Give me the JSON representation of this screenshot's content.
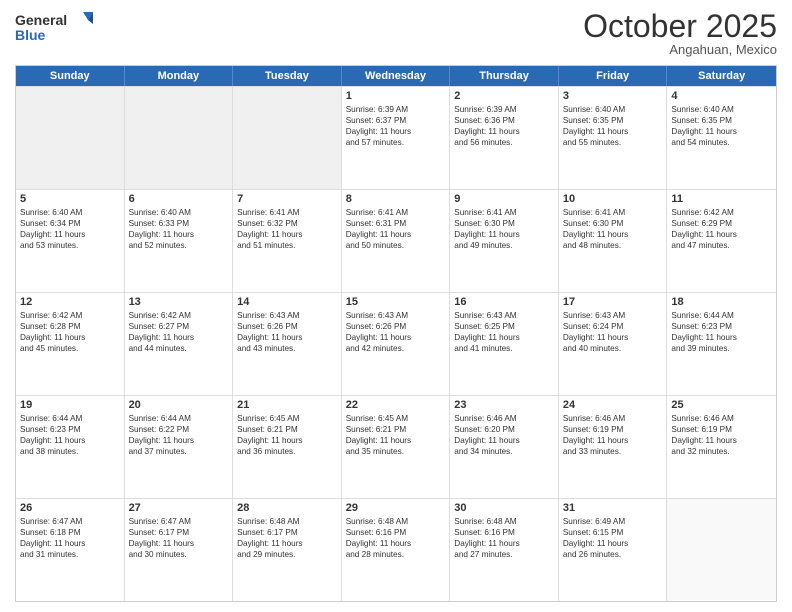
{
  "header": {
    "logo_general": "General",
    "logo_blue": "Blue",
    "month_title": "October 2025",
    "subtitle": "Angahuan, Mexico"
  },
  "days_of_week": [
    "Sunday",
    "Monday",
    "Tuesday",
    "Wednesday",
    "Thursday",
    "Friday",
    "Saturday"
  ],
  "weeks": [
    [
      {
        "day": "",
        "lines": []
      },
      {
        "day": "",
        "lines": []
      },
      {
        "day": "",
        "lines": []
      },
      {
        "day": "1",
        "lines": [
          "Sunrise: 6:39 AM",
          "Sunset: 6:37 PM",
          "Daylight: 11 hours",
          "and 57 minutes."
        ]
      },
      {
        "day": "2",
        "lines": [
          "Sunrise: 6:39 AM",
          "Sunset: 6:36 PM",
          "Daylight: 11 hours",
          "and 56 minutes."
        ]
      },
      {
        "day": "3",
        "lines": [
          "Sunrise: 6:40 AM",
          "Sunset: 6:35 PM",
          "Daylight: 11 hours",
          "and 55 minutes."
        ]
      },
      {
        "day": "4",
        "lines": [
          "Sunrise: 6:40 AM",
          "Sunset: 6:35 PM",
          "Daylight: 11 hours",
          "and 54 minutes."
        ]
      }
    ],
    [
      {
        "day": "5",
        "lines": [
          "Sunrise: 6:40 AM",
          "Sunset: 6:34 PM",
          "Daylight: 11 hours",
          "and 53 minutes."
        ]
      },
      {
        "day": "6",
        "lines": [
          "Sunrise: 6:40 AM",
          "Sunset: 6:33 PM",
          "Daylight: 11 hours",
          "and 52 minutes."
        ]
      },
      {
        "day": "7",
        "lines": [
          "Sunrise: 6:41 AM",
          "Sunset: 6:32 PM",
          "Daylight: 11 hours",
          "and 51 minutes."
        ]
      },
      {
        "day": "8",
        "lines": [
          "Sunrise: 6:41 AM",
          "Sunset: 6:31 PM",
          "Daylight: 11 hours",
          "and 50 minutes."
        ]
      },
      {
        "day": "9",
        "lines": [
          "Sunrise: 6:41 AM",
          "Sunset: 6:30 PM",
          "Daylight: 11 hours",
          "and 49 minutes."
        ]
      },
      {
        "day": "10",
        "lines": [
          "Sunrise: 6:41 AM",
          "Sunset: 6:30 PM",
          "Daylight: 11 hours",
          "and 48 minutes."
        ]
      },
      {
        "day": "11",
        "lines": [
          "Sunrise: 6:42 AM",
          "Sunset: 6:29 PM",
          "Daylight: 11 hours",
          "and 47 minutes."
        ]
      }
    ],
    [
      {
        "day": "12",
        "lines": [
          "Sunrise: 6:42 AM",
          "Sunset: 6:28 PM",
          "Daylight: 11 hours",
          "and 45 minutes."
        ]
      },
      {
        "day": "13",
        "lines": [
          "Sunrise: 6:42 AM",
          "Sunset: 6:27 PM",
          "Daylight: 11 hours",
          "and 44 minutes."
        ]
      },
      {
        "day": "14",
        "lines": [
          "Sunrise: 6:43 AM",
          "Sunset: 6:26 PM",
          "Daylight: 11 hours",
          "and 43 minutes."
        ]
      },
      {
        "day": "15",
        "lines": [
          "Sunrise: 6:43 AM",
          "Sunset: 6:26 PM",
          "Daylight: 11 hours",
          "and 42 minutes."
        ]
      },
      {
        "day": "16",
        "lines": [
          "Sunrise: 6:43 AM",
          "Sunset: 6:25 PM",
          "Daylight: 11 hours",
          "and 41 minutes."
        ]
      },
      {
        "day": "17",
        "lines": [
          "Sunrise: 6:43 AM",
          "Sunset: 6:24 PM",
          "Daylight: 11 hours",
          "and 40 minutes."
        ]
      },
      {
        "day": "18",
        "lines": [
          "Sunrise: 6:44 AM",
          "Sunset: 6:23 PM",
          "Daylight: 11 hours",
          "and 39 minutes."
        ]
      }
    ],
    [
      {
        "day": "19",
        "lines": [
          "Sunrise: 6:44 AM",
          "Sunset: 6:23 PM",
          "Daylight: 11 hours",
          "and 38 minutes."
        ]
      },
      {
        "day": "20",
        "lines": [
          "Sunrise: 6:44 AM",
          "Sunset: 6:22 PM",
          "Daylight: 11 hours",
          "and 37 minutes."
        ]
      },
      {
        "day": "21",
        "lines": [
          "Sunrise: 6:45 AM",
          "Sunset: 6:21 PM",
          "Daylight: 11 hours",
          "and 36 minutes."
        ]
      },
      {
        "day": "22",
        "lines": [
          "Sunrise: 6:45 AM",
          "Sunset: 6:21 PM",
          "Daylight: 11 hours",
          "and 35 minutes."
        ]
      },
      {
        "day": "23",
        "lines": [
          "Sunrise: 6:46 AM",
          "Sunset: 6:20 PM",
          "Daylight: 11 hours",
          "and 34 minutes."
        ]
      },
      {
        "day": "24",
        "lines": [
          "Sunrise: 6:46 AM",
          "Sunset: 6:19 PM",
          "Daylight: 11 hours",
          "and 33 minutes."
        ]
      },
      {
        "day": "25",
        "lines": [
          "Sunrise: 6:46 AM",
          "Sunset: 6:19 PM",
          "Daylight: 11 hours",
          "and 32 minutes."
        ]
      }
    ],
    [
      {
        "day": "26",
        "lines": [
          "Sunrise: 6:47 AM",
          "Sunset: 6:18 PM",
          "Daylight: 11 hours",
          "and 31 minutes."
        ]
      },
      {
        "day": "27",
        "lines": [
          "Sunrise: 6:47 AM",
          "Sunset: 6:17 PM",
          "Daylight: 11 hours",
          "and 30 minutes."
        ]
      },
      {
        "day": "28",
        "lines": [
          "Sunrise: 6:48 AM",
          "Sunset: 6:17 PM",
          "Daylight: 11 hours",
          "and 29 minutes."
        ]
      },
      {
        "day": "29",
        "lines": [
          "Sunrise: 6:48 AM",
          "Sunset: 6:16 PM",
          "Daylight: 11 hours",
          "and 28 minutes."
        ]
      },
      {
        "day": "30",
        "lines": [
          "Sunrise: 6:48 AM",
          "Sunset: 6:16 PM",
          "Daylight: 11 hours",
          "and 27 minutes."
        ]
      },
      {
        "day": "31",
        "lines": [
          "Sunrise: 6:49 AM",
          "Sunset: 6:15 PM",
          "Daylight: 11 hours",
          "and 26 minutes."
        ]
      },
      {
        "day": "",
        "lines": []
      }
    ]
  ]
}
